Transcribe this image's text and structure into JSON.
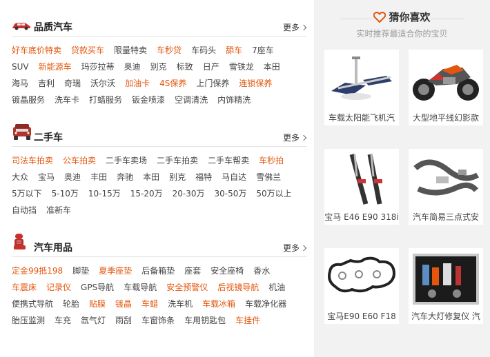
{
  "sections": [
    {
      "title": "品质汽车",
      "icon": "red-car-icon",
      "more_label": "更多",
      "rows": [
        [
          {
            "t": "好车底价特卖",
            "hot": true
          },
          {
            "t": "贷款买车",
            "hot": true
          },
          {
            "t": "限量特卖",
            "hot": false
          },
          {
            "t": "车秒贷",
            "hot": true
          },
          {
            "t": "车码头",
            "hot": false
          },
          {
            "t": "舔车",
            "hot": true
          },
          {
            "t": "7座车",
            "hot": false
          }
        ],
        [
          {
            "t": "SUV",
            "hot": false
          },
          {
            "t": "新能源车",
            "hot": true
          },
          {
            "t": "玛莎拉蒂",
            "hot": false
          },
          {
            "t": "奥迪",
            "hot": false
          },
          {
            "t": "别克",
            "hot": false
          },
          {
            "t": "标致",
            "hot": false
          },
          {
            "t": "日产",
            "hot": false
          },
          {
            "t": "雪铁龙",
            "hot": false
          },
          {
            "t": "本田",
            "hot": false
          }
        ],
        [
          {
            "t": "海马",
            "hot": false
          },
          {
            "t": "吉利",
            "hot": false
          },
          {
            "t": "奇瑞",
            "hot": false
          },
          {
            "t": "沃尔沃",
            "hot": false
          },
          {
            "t": "加油卡",
            "hot": true
          },
          {
            "t": "4S保养",
            "hot": true
          },
          {
            "t": "上门保养",
            "hot": false
          },
          {
            "t": "连锁保养",
            "hot": true
          }
        ],
        [
          {
            "t": "镀晶服务",
            "hot": false
          },
          {
            "t": "洗车卡",
            "hot": false
          },
          {
            "t": "打蜡服务",
            "hot": false
          },
          {
            "t": "钣金喷漆",
            "hot": false
          },
          {
            "t": "空调清洗",
            "hot": false
          },
          {
            "t": "内饰精洗",
            "hot": false
          }
        ]
      ]
    },
    {
      "title": "二手车",
      "icon": "jeep-icon",
      "more_label": "更多",
      "rows": [
        [
          {
            "t": "司法车拍卖",
            "hot": true
          },
          {
            "t": "公车拍卖",
            "hot": true
          },
          {
            "t": "二手车卖场",
            "hot": false
          },
          {
            "t": "二手车拍卖",
            "hot": false
          },
          {
            "t": "二手车帮卖",
            "hot": false
          },
          {
            "t": "车秒拍",
            "hot": true
          }
        ],
        [
          {
            "t": "大众",
            "hot": false
          },
          {
            "t": "宝马",
            "hot": false
          },
          {
            "t": "奥迪",
            "hot": false
          },
          {
            "t": "丰田",
            "hot": false
          },
          {
            "t": "奔驰",
            "hot": false
          },
          {
            "t": "本田",
            "hot": false
          },
          {
            "t": "别克",
            "hot": false
          },
          {
            "t": "福特",
            "hot": false
          },
          {
            "t": "马自达",
            "hot": false
          },
          {
            "t": "雪佛兰",
            "hot": false
          }
        ],
        [
          {
            "t": "5万以下",
            "hot": false
          },
          {
            "t": "5-10万",
            "hot": false
          },
          {
            "t": "10-15万",
            "hot": false
          },
          {
            "t": "15-20万",
            "hot": false
          },
          {
            "t": "20-30万",
            "hot": false
          },
          {
            "t": "30-50万",
            "hot": false
          },
          {
            "t": "50万以上",
            "hot": false
          }
        ],
        [
          {
            "t": "自动挡",
            "hot": false
          },
          {
            "t": "准新车",
            "hot": false
          }
        ]
      ]
    },
    {
      "title": "汽车用品",
      "icon": "car-seat-icon",
      "more_label": "更多",
      "rows": [
        [
          {
            "t": "定金99抵198",
            "hot": true
          },
          {
            "t": "脚垫",
            "hot": false
          },
          {
            "t": "夏季座垫",
            "hot": true
          },
          {
            "t": "后备箱垫",
            "hot": false
          },
          {
            "t": "座套",
            "hot": false
          },
          {
            "t": "安全座椅",
            "hot": false
          },
          {
            "t": "香水",
            "hot": false
          }
        ],
        [
          {
            "t": "车震床",
            "hot": true
          },
          {
            "t": "记录仪",
            "hot": true
          },
          {
            "t": "GPS导航",
            "hot": false
          },
          {
            "t": "车载导航",
            "hot": false
          },
          {
            "t": "安全预警仪",
            "hot": true
          },
          {
            "t": "后视镜导航",
            "hot": true
          },
          {
            "t": "机油",
            "hot": false
          }
        ],
        [
          {
            "t": "便携式导航",
            "hot": false
          },
          {
            "t": "轮胎",
            "hot": false
          },
          {
            "t": "贴膜",
            "hot": true
          },
          {
            "t": "镀晶",
            "hot": true
          },
          {
            "t": "车蜡",
            "hot": true
          },
          {
            "t": "洗车机",
            "hot": false
          },
          {
            "t": "车载冰箱",
            "hot": true
          },
          {
            "t": "车载净化器",
            "hot": false
          }
        ],
        [
          {
            "t": "胎压监测",
            "hot": false
          },
          {
            "t": "车充",
            "hot": false
          },
          {
            "t": "氙气灯",
            "hot": false
          },
          {
            "t": "雨刮",
            "hot": false
          },
          {
            "t": "车窗饰条",
            "hot": false
          },
          {
            "t": "车用钥匙包",
            "hot": false
          },
          {
            "t": "车挂件",
            "hot": true
          }
        ]
      ]
    }
  ],
  "guess": {
    "title": "猜你喜欢",
    "subtitle": "实时推荐最适合你的宝贝",
    "heart_icon": "heart-icon",
    "products": [
      {
        "caption": "车载太阳能飞机汽",
        "icon": "solar-airplane-image"
      },
      {
        "caption": "大型地平线幻影款",
        "icon": "motorcycle-image"
      },
      {
        "caption": "宝马 E46 E90 318i",
        "icon": "shock-absorber-image"
      },
      {
        "caption": "汽车简易三点式安",
        "icon": "seat-belt-image"
      },
      {
        "caption": "宝马E90 E60 F18",
        "icon": "gasket-image"
      },
      {
        "caption": "汽车大灯修复仪 汽",
        "icon": "headlight-repair-kit-image"
      }
    ]
  },
  "colors": {
    "hot": "#e4560d",
    "normal": "#444444",
    "panel": "#f2f2f2",
    "heart": "#e4560d"
  }
}
